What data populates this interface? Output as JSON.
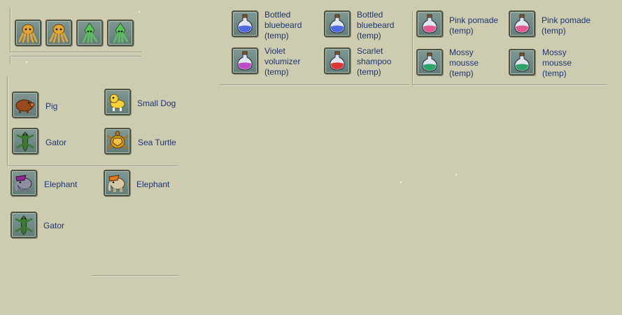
{
  "top_left": {
    "slots": [
      {
        "icon": "octopus-orange-icon",
        "color": "#e3a637"
      },
      {
        "icon": "octopus-orange-icon",
        "color": "#e3a637"
      },
      {
        "icon": "squid-green-icon",
        "color": "#5cc25a"
      },
      {
        "icon": "squid-green-icon",
        "color": "#5cc25a"
      }
    ]
  },
  "pets": {
    "section1": [
      {
        "label": "Pig",
        "icon": "pig-icon"
      },
      {
        "label": "Small Dog",
        "icon": "small-dog-icon"
      },
      {
        "label": "Gator",
        "icon": "gator-icon"
      },
      {
        "label": "Sea Turtle",
        "icon": "sea-turtle-icon"
      }
    ],
    "section2": [
      {
        "label": "Elephant",
        "icon": "elephant-purple-icon"
      },
      {
        "label": "Elephant",
        "icon": "elephant-orange-icon"
      },
      {
        "label": "Gator",
        "icon": "gator-icon"
      }
    ]
  },
  "potions": [
    {
      "label": "Bottled bluebeard (temp)",
      "color": "#4f6be0"
    },
    {
      "label": "Bottled bluebeard (temp)",
      "color": "#4f6be0"
    },
    {
      "label": "Pink pomade (temp)",
      "color": "#e25a8f"
    },
    {
      "label": "Pink pomade (temp)",
      "color": "#e25a8f"
    },
    {
      "label": "Violet volumizer (temp)",
      "color": "#c04ac8"
    },
    {
      "label": "Scarlet shampoo (temp)",
      "color": "#d83838"
    },
    {
      "label": "Mossy mousse (temp)",
      "color": "#2fa46a"
    },
    {
      "label": "Mossy mousse (temp)",
      "color": "#2fa46a"
    }
  ]
}
